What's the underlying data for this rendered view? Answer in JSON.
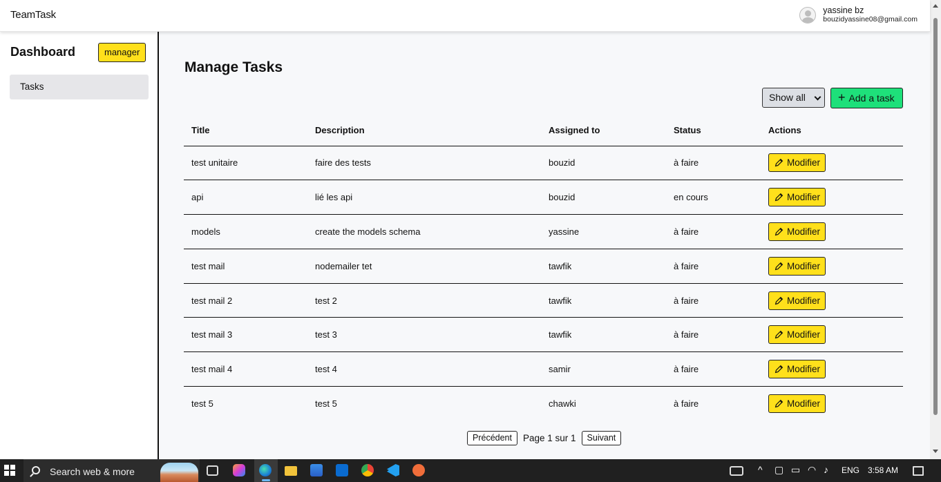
{
  "app": {
    "brand": "TeamTask"
  },
  "user": {
    "name": "yassine bz",
    "email": "bouzidyassine08@gmail.com"
  },
  "sidebar": {
    "title": "Dashboard",
    "role_badge": "manager",
    "items": [
      {
        "label": "Tasks"
      }
    ]
  },
  "main": {
    "title": "Manage Tasks",
    "filter": {
      "selected": "Show all"
    },
    "add_button": "Add a task",
    "table": {
      "headers": [
        "Title",
        "Description",
        "Assigned to",
        "Status",
        "Actions"
      ],
      "action_label": "Modifier",
      "rows": [
        {
          "title": "test unitaire",
          "description": "faire des tests",
          "assigned": "bouzid",
          "status": "à faire"
        },
        {
          "title": "api",
          "description": "lié les api",
          "assigned": "bouzid",
          "status": "en cours"
        },
        {
          "title": "models",
          "description": "create the models schema",
          "assigned": "yassine",
          "status": "à faire"
        },
        {
          "title": "test mail",
          "description": "nodemailer tet",
          "assigned": "tawfik",
          "status": "à faire"
        },
        {
          "title": "test mail 2",
          "description": "test 2",
          "assigned": "tawfik",
          "status": "à faire"
        },
        {
          "title": "test mail 3",
          "description": "test 3",
          "assigned": "tawfik",
          "status": "à faire"
        },
        {
          "title": "test mail 4",
          "description": "test 4",
          "assigned": "samir",
          "status": "à faire"
        },
        {
          "title": "test 5",
          "description": "test 5",
          "assigned": "chawki",
          "status": "à faire"
        }
      ]
    },
    "pagination": {
      "prev": "Précédent",
      "page_text": "Page 1 sur 1",
      "next": "Suivant"
    }
  },
  "taskbar": {
    "search_placeholder": "Search web & more",
    "language": "ENG",
    "time": "3:58 AM",
    "colors": {
      "background": "#202020",
      "active_indicator": "#6cb8f6"
    }
  },
  "colors": {
    "accent_yellow": "#ffe01b",
    "accent_green": "#1ee07a",
    "main_bg": "#f7f8fa"
  }
}
